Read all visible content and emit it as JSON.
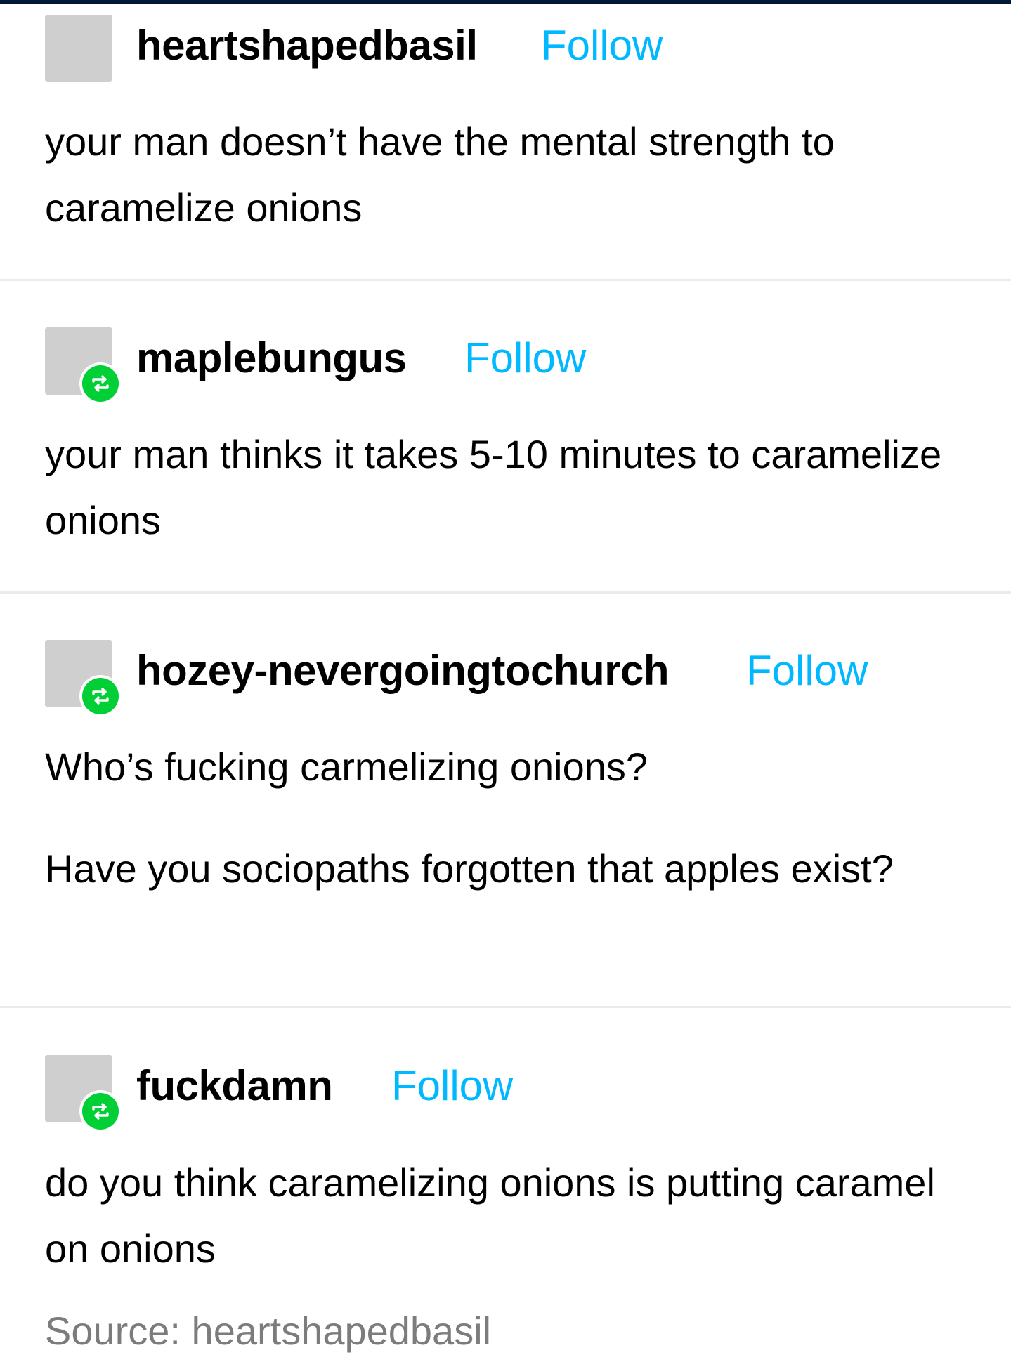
{
  "posts": [
    {
      "username": "heartshapedbasil",
      "follow_label": "Follow",
      "paragraphs": [
        "your man doesn’t have the mental strength to caramelize onions"
      ],
      "reblog": false
    },
    {
      "username": "maplebungus",
      "follow_label": "Follow",
      "paragraphs": [
        "your man thinks it takes 5-10 minutes to caramelize onions"
      ],
      "reblog": true
    },
    {
      "username": "hozey-nevergoingtochurch",
      "follow_label": "Follow",
      "paragraphs": [
        "Who’s fucking carmelizing onions?",
        "Have you sociopaths forgotten that apples exist?"
      ],
      "reblog": true
    },
    {
      "username": "fuckdamn",
      "follow_label": "Follow",
      "paragraphs": [
        "do you think caramelizing onions is putting caramel on onions"
      ],
      "reblog": true
    }
  ],
  "source": "Source: heartshapedbasil",
  "icons": {
    "reblog": "reblog-icon"
  },
  "colors": {
    "follow": "#00b8ff",
    "reblog_badge": "#00cf35",
    "avatar_placeholder": "#cfcfcf",
    "source_text": "#7c7c7c"
  }
}
